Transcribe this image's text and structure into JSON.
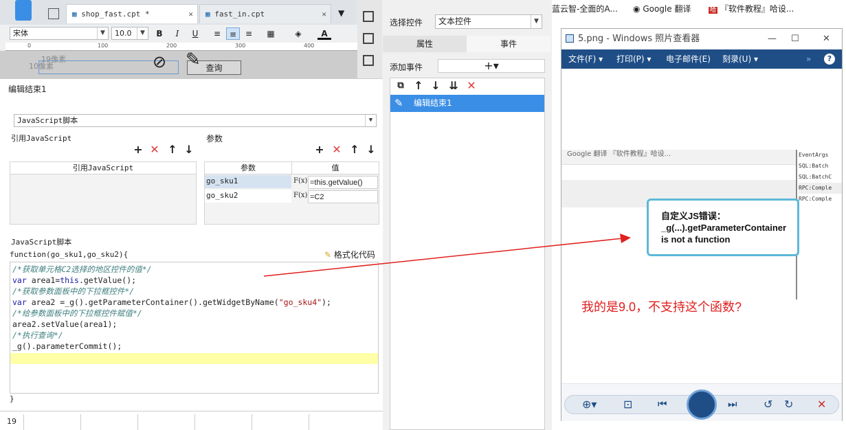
{
  "designer": {
    "tabs": [
      {
        "label": "shop_fast.cpt *"
      },
      {
        "label": "fast_in.cpt"
      }
    ],
    "font": "宋体",
    "font_size": "10.0",
    "ruler_ticks": [
      "0",
      "100",
      "200",
      "300",
      "400"
    ],
    "ghost_labels": [
      "19像素",
      "10像素"
    ],
    "query_button": "查询"
  },
  "dialog": {
    "title": "编辑结束1",
    "type_select": "JavaScript脚本",
    "ref_section": "引用JavaScript",
    "ref_column": "引用JavaScript",
    "param_section": "参数",
    "param_headers": [
      "参数",
      "值"
    ],
    "params": [
      {
        "name": "go_sku1",
        "fx": "F(x)",
        "value": "=this.getValue()"
      },
      {
        "name": "go_sku2",
        "fx": "F(x)",
        "value": "=C2"
      }
    ],
    "script_section": "JavaScript脚本",
    "func_signature": "function(go_sku1,go_sku2){",
    "format_button": "格式化代码",
    "code_lines": [
      {
        "type": "comment",
        "text": "/*获取单元格C2选择的地区控件的值*/"
      },
      {
        "type": "code",
        "kw": "var ",
        "text": "area1=",
        "kw2": "this",
        "rest": ".getValue();"
      },
      {
        "type": "comment",
        "text": "/*获取参数面板中的下拉框控件*/"
      },
      {
        "type": "code2",
        "kw": "var ",
        "text": "area2 =_g().getParameterContainer().getWidgetByName(",
        "str": "\"go_sku4\"",
        "rest": ");"
      },
      {
        "type": "comment",
        "text": "/*给参数面板中的下拉框控件赋值*/"
      },
      {
        "type": "plain",
        "text": "area2.setValue(area1);"
      },
      {
        "type": "comment",
        "text": "/*执行查询*/"
      },
      {
        "type": "plain",
        "text": "_g().parameterCommit();"
      }
    ],
    "closing_brace": "}",
    "row_number": "19"
  },
  "mid_panel": {
    "select_control_label": "选择控件",
    "select_control_value": "文本控件",
    "tabs": [
      "属性",
      "事件"
    ],
    "add_event_label": "添加事件",
    "event_item": "编辑结束1"
  },
  "bookmarks": [
    "蓝云智-全面的A...",
    "Google 翻译",
    "『软件教程』哈设..."
  ],
  "viewer": {
    "title": "5.png - Windows 照片查看器",
    "menu": [
      "文件(F)",
      "打印(P)",
      "电子邮件(E)",
      "刻录(U)"
    ],
    "inner_bookmarks": "Google 翻译      『软件教程』哈设...",
    "log_lines": [
      "EventArgs",
      "SQL:Batch",
      "SQL:BatchC",
      "RPC:Comple",
      "RPC:Comple"
    ],
    "error_lines": [
      "自定义JS错误：",
      "_g(...).getParameterContainer",
      "is not a function"
    ],
    "note": "我的是9.0，不支持这个函数?"
  },
  "colors": {
    "accent": "#3a8ee6",
    "viewer_menu": "#1f4e86",
    "annotation": "#e02020"
  }
}
